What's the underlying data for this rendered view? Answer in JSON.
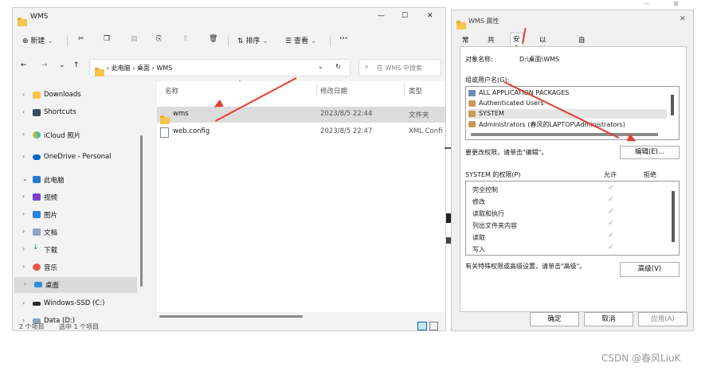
{
  "explorer": {
    "title": "WMS",
    "window_controls": {
      "minimize": "—",
      "maximize": "☐",
      "close": "✕"
    },
    "toolbar": {
      "new_label": "新建",
      "sort_label": "排序",
      "view_label": "查看",
      "more_label": "···"
    },
    "address": {
      "crumbs": [
        "此电脑",
        "桌面",
        "WMS"
      ],
      "search_placeholder": "在 WMS 中搜索"
    },
    "nav": {
      "items": [
        {
          "label": "Downloads"
        },
        {
          "label": "Shortcuts"
        },
        {
          "label": "iCloud 照片"
        },
        {
          "label": "OneDrive - Personal"
        },
        {
          "label": "此电脑"
        },
        {
          "label": "视频"
        },
        {
          "label": "图片"
        },
        {
          "label": "文档"
        },
        {
          "label": "下载"
        },
        {
          "label": "音乐"
        },
        {
          "label": "桌面"
        },
        {
          "label": "Windows-SSD (C:)"
        },
        {
          "label": "Data (D:)"
        }
      ]
    },
    "columns": {
      "name": "名称",
      "date": "修改日期",
      "type": "类型"
    },
    "files": [
      {
        "name": "wms",
        "date": "2023/8/5 22:44",
        "type": "文件夹"
      },
      {
        "name": "web.config",
        "date": "2023/8/5 22:47",
        "type": "XML Confi"
      }
    ],
    "status": {
      "count": "2 个项目",
      "selected": "选中 1 个项目"
    }
  },
  "dialog": {
    "title": "WMS 属性",
    "close": "✕",
    "tabs": [
      "常规",
      "共享",
      "安全",
      "以前的版本",
      "自定义"
    ],
    "object_label": "对象名称:",
    "object_value": "D:\\桌面\\WMS",
    "group_label": "组或用户名(G):",
    "users": [
      "ALL APPLICATION PACKAGES",
      "Authenticated Users",
      "SYSTEM",
      "Administrators (春风的LAPTOP\\Administrators)"
    ],
    "change_text": "要更改权限，请单击\"编辑\"。",
    "edit_button": "编辑(E)...",
    "perm_label": "SYSTEM 的权限(P)",
    "allow_label": "允许",
    "deny_label": "拒绝",
    "permissions": [
      "完全控制",
      "修改",
      "读取和执行",
      "列出文件夹内容",
      "读取",
      "写入"
    ],
    "advanced_text": "有关特殊权限或高级设置，请单击\"高级\"。",
    "advanced_button": "高级(V)",
    "ok_button": "确定",
    "cancel_button": "取消",
    "apply_button": "应用(A)"
  },
  "watermark": "CSDN @春风LiuK",
  "colors": {
    "arrow": "#e53d2f",
    "selection": "#cce4f7",
    "accent": "#0067c0"
  }
}
